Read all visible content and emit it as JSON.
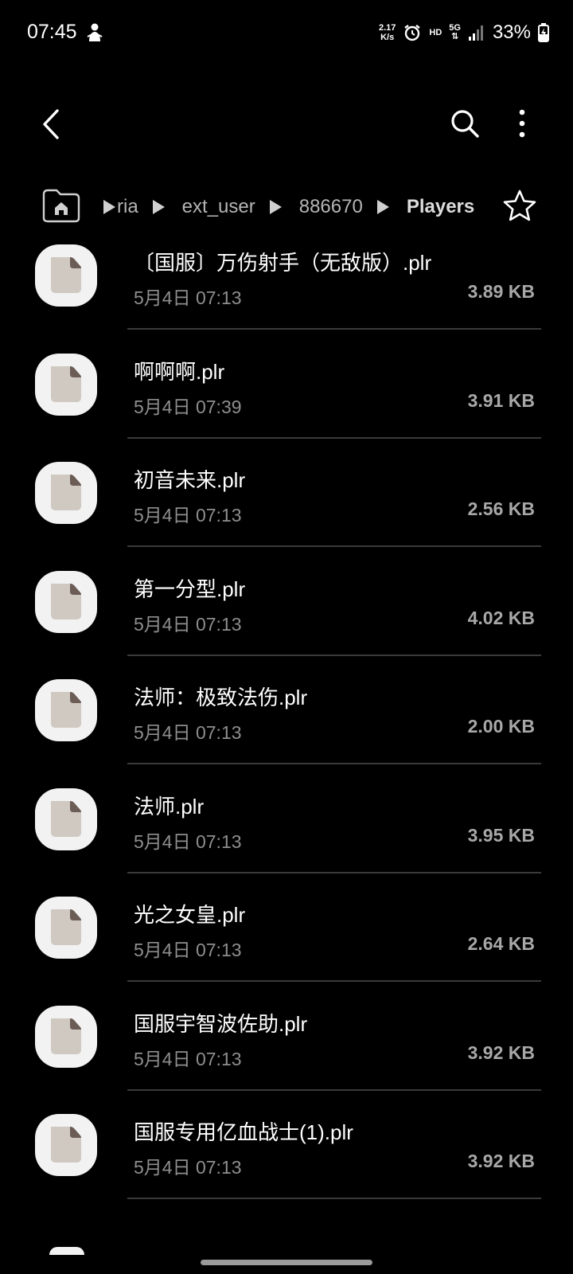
{
  "status_bar": {
    "time": "07:45",
    "net_speed_value": "2.17",
    "net_speed_unit": "K/s",
    "hd": "HD",
    "network": "5G",
    "battery": "33%"
  },
  "app_bar": {
    "back_icon": "chevron-left-icon",
    "search_icon": "search-icon",
    "more_icon": "more-vert-icon"
  },
  "breadcrumb": {
    "items": [
      "ria",
      "ext_user",
      "886670",
      "Players"
    ]
  },
  "files": [
    {
      "name": "〔国服〕万伤射手（无敌版）.plr",
      "date": "5月4日 07:13",
      "size": "3.89 KB"
    },
    {
      "name": "啊啊啊.plr",
      "date": "5月4日 07:39",
      "size": "3.91 KB"
    },
    {
      "name": "初音未来.plr",
      "date": "5月4日 07:13",
      "size": "2.56 KB"
    },
    {
      "name": "第一分型.plr",
      "date": "5月4日 07:13",
      "size": "4.02 KB"
    },
    {
      "name": "法师：极致法伤.plr",
      "date": "5月4日 07:13",
      "size": "2.00 KB"
    },
    {
      "name": "法师.plr",
      "date": "5月4日 07:13",
      "size": "3.95 KB"
    },
    {
      "name": "光之女皇.plr",
      "date": "5月4日 07:13",
      "size": "2.64 KB"
    },
    {
      "name": "国服宇智波佐助.plr",
      "date": "5月4日 07:13",
      "size": "3.92 KB"
    },
    {
      "name": "国服专用亿血战士(1).plr",
      "date": "5月4日 07:13",
      "size": "3.92 KB"
    }
  ],
  "colors": {
    "background": "#000000",
    "icon_bg": "#f2f2f2",
    "icon_doc": "#cfc9c1",
    "icon_fold": "#6b5c55",
    "secondary_text": "#8e8e8e"
  }
}
